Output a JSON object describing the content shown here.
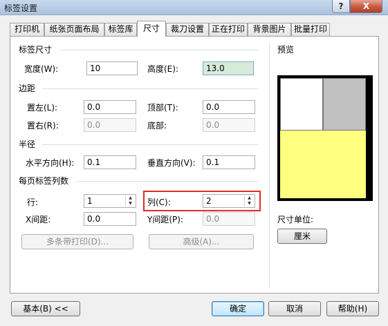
{
  "window": {
    "title": "标签设置",
    "help_button": "?",
    "close_button": "X"
  },
  "tabs": [
    {
      "label": "打印机"
    },
    {
      "label": "纸张页面布局"
    },
    {
      "label": "标签库"
    },
    {
      "label": "尺寸"
    },
    {
      "label": "裁刀设置"
    },
    {
      "label": "正在打印"
    },
    {
      "label": "背景图片"
    },
    {
      "label": "批量打印"
    }
  ],
  "size_group": {
    "title": "标签尺寸",
    "width_label": "宽度(W):",
    "width_value": "10",
    "height_label": "高度(E):",
    "height_value": "13.0"
  },
  "margin_group": {
    "title": "边距",
    "left_label": "置左(L):",
    "left_value": "0.0",
    "top_label": "顶部(T):",
    "top_value": "0.0",
    "right_label": "置右(R):",
    "right_value": "0.0",
    "bottom_label": "底部:",
    "bottom_value": "0.0"
  },
  "radius_group": {
    "title": "半径",
    "horizontal_label": "水平方向(H):",
    "horizontal_value": "0.1",
    "vertical_label": "垂直方向(V):",
    "vertical_value": "0.1"
  },
  "columns_group": {
    "title": "每页标签列数",
    "rows_label": "行:",
    "rows_value": "1",
    "cols_label": "列(C):",
    "cols_value": "2",
    "xgap_label": "X间距:",
    "xgap_value": "0.0",
    "ygap_label": "Y间距(P):",
    "ygap_value": "0.0",
    "multi_strip_button": "多条带打印(D)...",
    "advanced_button": "高级(A)..."
  },
  "preview": {
    "title": "预览",
    "unit_label": "尺寸单位:",
    "unit_button": "厘米"
  },
  "footer": {
    "basic_button": "基本(B) <<",
    "ok_button": "确定",
    "cancel_button": "取消",
    "help_button": "帮助(H)"
  },
  "colors": {
    "highlight_border": "#e1282a",
    "preview_label_area": "#ffff80",
    "preview_column_2": "#c0c0c0"
  }
}
